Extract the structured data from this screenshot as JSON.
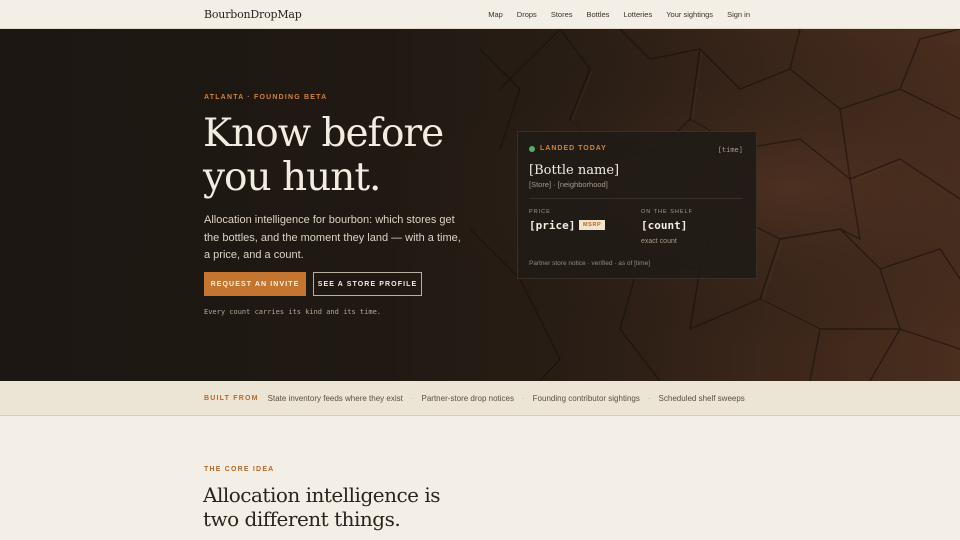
{
  "nav": {
    "brand": "BourbonDropMap",
    "links": [
      "Map",
      "Drops",
      "Stores",
      "Bottles",
      "Lotteries",
      "Your sightings",
      "Sign in"
    ]
  },
  "hero": {
    "eyebrow": "ATLANTA · FOUNDING BETA",
    "headline": "Know before you hunt.",
    "subhead": "Allocation intelligence for bourbon: which stores get the bottles, and the moment they land — with a time, a price, and a count.",
    "primary_button": "REQUEST AN INVITE",
    "secondary_button": "SEE A STORE PROFILE",
    "caption": "Every count carries its kind and its time."
  },
  "card": {
    "status": "LANDED TODAY",
    "status_color": "#4fb06a",
    "time": "[time]",
    "bottle": "[Bottle name]",
    "store": "[Store] · [neighborhood]",
    "price_label": "PRICE",
    "price": "[price]",
    "msrp_badge": "MSRP",
    "shelf_label": "ON THE SHELF",
    "count": "[count]",
    "count_sub": "exact count",
    "footnote": "Partner store notice · verified · as of [time]"
  },
  "built_from": {
    "label": "BUILT FROM",
    "items": [
      "State inventory feeds where they exist",
      "Partner-store drop notices",
      "Founding contributor sightings",
      "Scheduled shelf sweeps"
    ],
    "separator": "·"
  },
  "core": {
    "eyebrow": "THE CORE IDEA",
    "headline": "Allocation intelligence is two different things."
  },
  "colors": {
    "accent": "#c4752f",
    "hero_bg": "#1c1713",
    "page_bg": "#f4efe6"
  }
}
